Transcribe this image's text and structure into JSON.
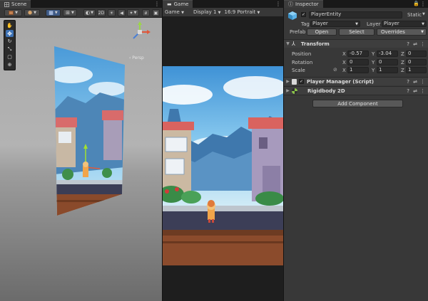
{
  "scene": {
    "tab_label": "Scene",
    "toolbar": {
      "mode_2d": "2D"
    },
    "persp_label": "‹ Persp"
  },
  "game": {
    "tab_label": "Game",
    "display_select": "Game",
    "display_label": "Display 1",
    "aspect_label": "16:9 Portrait"
  },
  "inspector": {
    "tab_label": "Inspector",
    "object_name": "PlayerEntity",
    "static_label": "Static",
    "tag_label": "Tag",
    "tag_value": "Player",
    "layer_label": "Layer",
    "layer_value": "Player",
    "prefab_label": "Prefab",
    "prefab_open": "Open",
    "prefab_select": "Select",
    "prefab_overrides": "Overrides",
    "transform": {
      "title": "Transform",
      "position_label": "Position",
      "rotation_label": "Rotation",
      "scale_label": "Scale",
      "position": {
        "x": "-0.57",
        "y": "-3.04",
        "z": "0"
      },
      "rotation": {
        "x": "0",
        "y": "0",
        "z": "0"
      },
      "scale": {
        "x": "1",
        "y": "1",
        "z": "1"
      }
    },
    "components": [
      {
        "title": "Player Manager (Script)"
      },
      {
        "title": "Rigidbody 2D"
      }
    ],
    "add_component": "Add Component",
    "axis_x": "X",
    "axis_y": "Y",
    "axis_z": "Z"
  },
  "colors": {
    "accent": "#3e73b6",
    "panel_bg": "#383838",
    "sky": "#6fb9ea"
  }
}
